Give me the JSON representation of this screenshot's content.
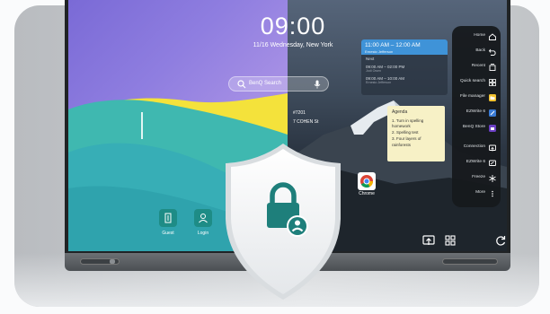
{
  "home": {
    "time": "09:00",
    "date": "11/16 Wednesday, New York"
  },
  "search": {
    "placeholder": "BenQ Search"
  },
  "calendar": {
    "header_time": "11:00 AM – 12:00 AM",
    "header_sub": "Ernesto Jefferson",
    "section": "Next",
    "events": [
      {
        "time": "09:00 AM – 02:00 PM",
        "sub": "Jodi Owen"
      },
      {
        "time": "09:00 AM – 10:00 AM",
        "sub": "Ernesto Jefferson"
      }
    ]
  },
  "agenda": {
    "title": "Agenda",
    "items": [
      "1. Turn in spelling homework",
      "2. Spelling test",
      "3. Four layers of rainforests"
    ]
  },
  "location": {
    "line1": "#7201",
    "line2": "7 COHEN St"
  },
  "apps": {
    "chrome": "Chrome"
  },
  "account": {
    "guest": "Guest",
    "login": "Login"
  },
  "sidebar": {
    "items": [
      {
        "label": "Home",
        "icon": "home-icon"
      },
      {
        "label": "Back",
        "icon": "back-icon"
      },
      {
        "label": "Recent",
        "icon": "recent-icon"
      },
      {
        "label": "Quick search",
        "icon": "grid-icon"
      },
      {
        "label": "File manager",
        "icon": "folder-icon"
      },
      {
        "label": "EZWrite 6",
        "icon": "ezwrite-icon"
      },
      {
        "label": "BenQ Store",
        "icon": "store-icon"
      },
      {
        "label": "Connection",
        "icon": "connection-icon"
      },
      {
        "label": "EZWrite 6",
        "icon": "whiteboard-icon"
      },
      {
        "label": "Freeze",
        "icon": "freeze-icon"
      },
      {
        "label": "More",
        "icon": "more-icon"
      }
    ]
  },
  "colors": {
    "accent": "#1e8c86",
    "calendar_header": "#3f93d8",
    "note": "#f7f1c6",
    "sidebar": "#16191c"
  }
}
